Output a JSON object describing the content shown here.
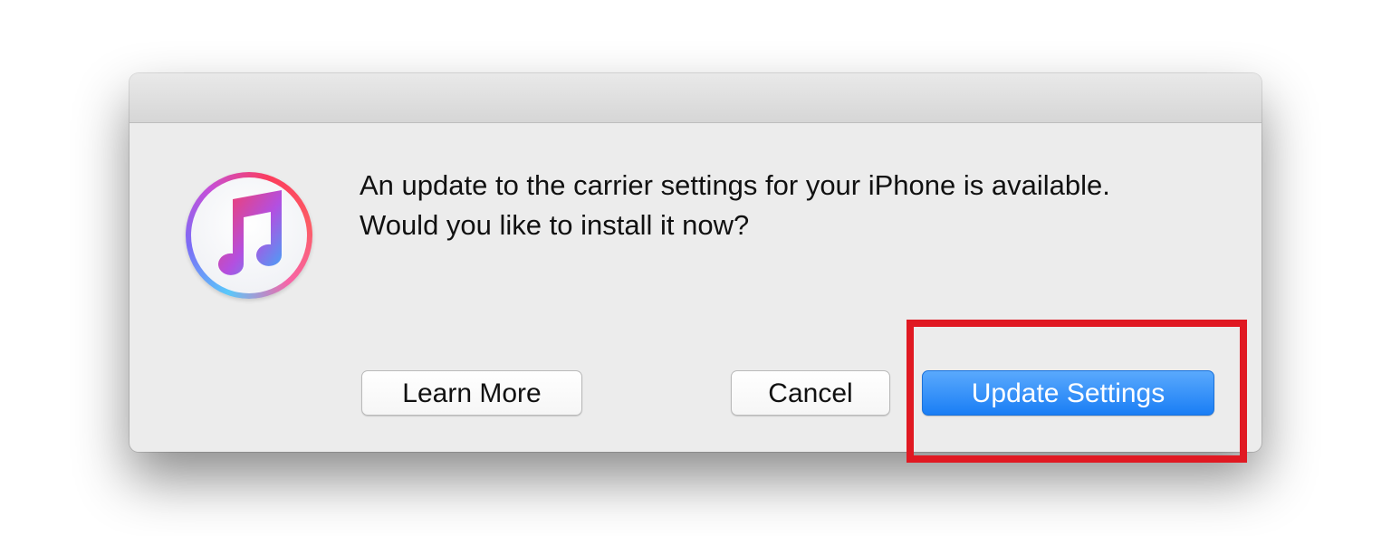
{
  "dialog": {
    "message_line1": "An update to the carrier settings for your iPhone is available.",
    "message_line2": "Would you like to install it now?",
    "app_icon": "itunes-music-note-icon"
  },
  "buttons": {
    "learn_more": "Learn More",
    "cancel": "Cancel",
    "update_settings": "Update Settings"
  },
  "colors": {
    "primary_button": "#1a7ef5",
    "highlight": "#e01922",
    "dialog_bg": "#ececec"
  }
}
